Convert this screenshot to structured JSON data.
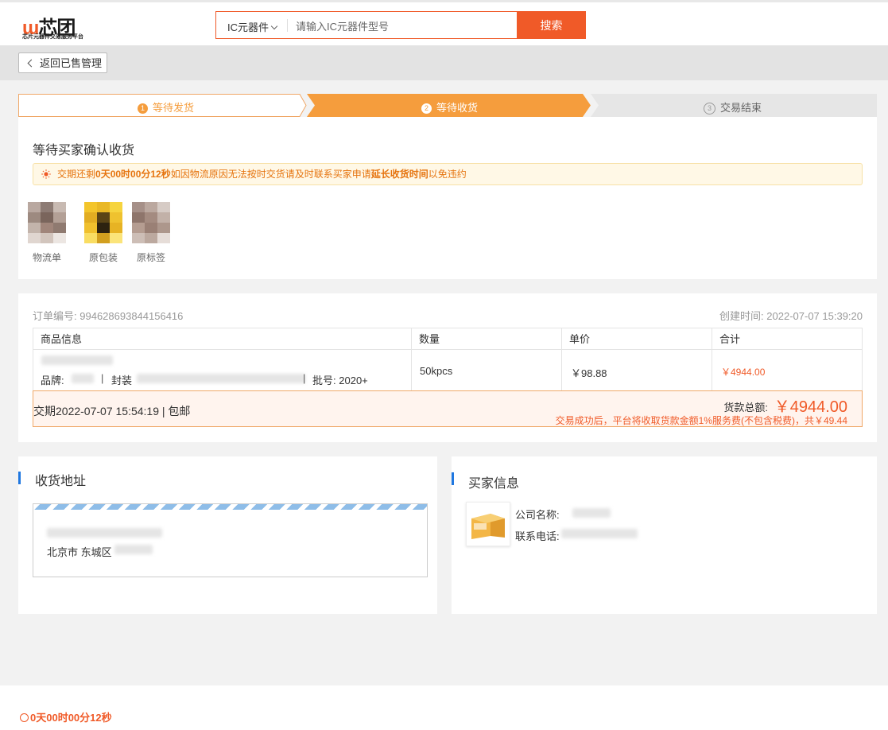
{
  "header": {
    "logo_text": "芯团",
    "logo_subtitle": "芯片元器件交易服务平台",
    "search": {
      "category": "IC元器件",
      "placeholder": "请输入IC元器件型号",
      "button_label": "搜索"
    }
  },
  "nav": {
    "back_label": "返回已售管理"
  },
  "steps": [
    {
      "num": "1",
      "label": "等待发货",
      "state": "done"
    },
    {
      "num": "2",
      "label": "等待收货",
      "state": "active"
    },
    {
      "num": "3",
      "label": "交易结束",
      "state": "pending"
    }
  ],
  "status": {
    "title": "等待买家确认收货",
    "notice": {
      "prefix": "交期还剩",
      "countdown": "0天00时00分12秒",
      "middle": "如因物流原因无法按时交货请及时联系买家申请",
      "highlight": "延长收货时间",
      "suffix": "以免违约"
    },
    "attachments": [
      {
        "label": "物流单"
      },
      {
        "label": "原包装"
      },
      {
        "label": "原标签"
      }
    ]
  },
  "order": {
    "number_label": "订单编号:",
    "number": "994628693844156416",
    "created_label": "创建时间:",
    "created": "2022-07-07 15:39:20",
    "columns": [
      "商品信息",
      "数量",
      "单价",
      "合计"
    ],
    "item": {
      "brand_label": "品牌:",
      "package_label": "封装",
      "batch_label": "批号:",
      "batch": "2020+",
      "quantity": "50kpcs",
      "unit_price": "￥98.88",
      "subtotal": "￥4944.00"
    },
    "delivery": "交期2022-07-07 15:54:19 | 包邮",
    "total_label": "货款总额:",
    "total_amount": "￥4944.00",
    "fee_note": "交易成功后，平台将收取货款金额1%服务费(不包含税费)，共￥49.44"
  },
  "address": {
    "title": "收货地址",
    "city": "北京市 东城区"
  },
  "buyer": {
    "title": "买家信息",
    "company_label": "公司名称:",
    "phone_label": "联系电话:"
  },
  "footer": {
    "countdown": "0天00时00分12秒"
  },
  "colors": {
    "brand_orange": "#f05a28",
    "step_active": "#f59d3d",
    "accent_blue": "#1f77e0"
  }
}
